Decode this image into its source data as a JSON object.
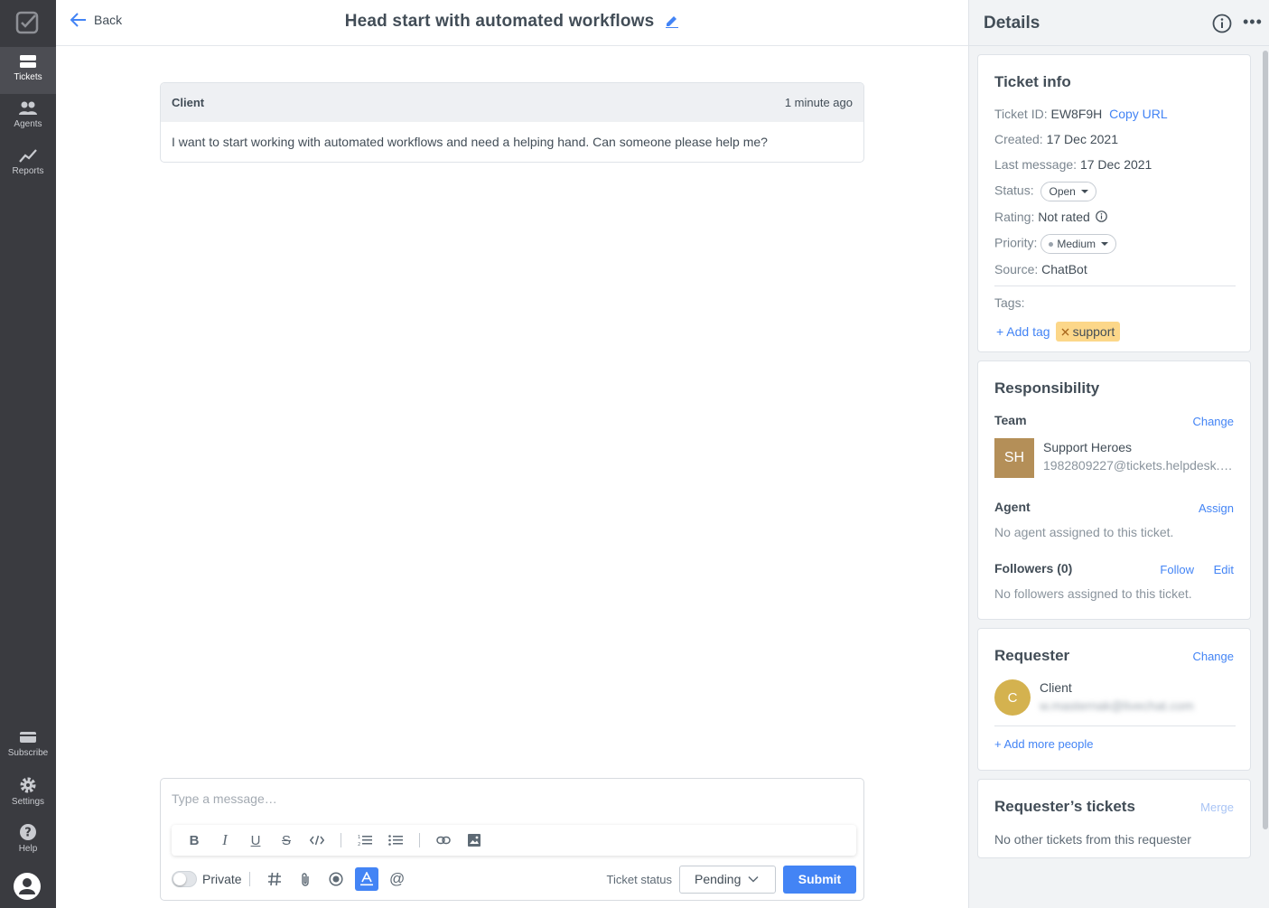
{
  "nav": {
    "items": [
      {
        "label": "Tickets",
        "icon": "ticket-icon"
      },
      {
        "label": "Agents",
        "icon": "agents-icon"
      },
      {
        "label": "Reports",
        "icon": "reports-icon"
      }
    ],
    "bottom_items": [
      {
        "label": "Subscribe",
        "icon": "subscribe-icon"
      },
      {
        "label": "Settings",
        "icon": "gear-icon"
      },
      {
        "label": "Help",
        "icon": "help-icon"
      }
    ]
  },
  "header": {
    "back_label": "Back",
    "title": "Head start with automated workflows"
  },
  "message": {
    "author": "Client",
    "time": "1 minute ago",
    "body": "I want to start working with automated workflows and need a helping hand. Can someone please help me?"
  },
  "composer": {
    "placeholder": "Type a message…",
    "private_label": "Private",
    "ticket_status_label": "Ticket status",
    "status_value": "Pending",
    "submit_label": "Submit"
  },
  "details": {
    "title": "Details",
    "ticket_info": {
      "title": "Ticket info",
      "ticket_id_label": "Ticket ID:",
      "ticket_id": "EW8F9H",
      "copy_url": "Copy URL",
      "created_label": "Created:",
      "created": "17 Dec 2021",
      "last_message_label": "Last message:",
      "last_message": "17 Dec 2021",
      "status_label": "Status:",
      "status": "Open",
      "rating_label": "Rating:",
      "rating": "Not rated",
      "priority_label": "Priority:",
      "priority": "Medium",
      "source_label": "Source:",
      "source": "ChatBot",
      "tags_label": "Tags:",
      "add_tag": "+ Add tag",
      "tag": "support"
    },
    "responsibility": {
      "title": "Responsibility",
      "team_label": "Team",
      "team_change": "Change",
      "team_initials": "SH",
      "team_name": "Support Heroes",
      "team_email": "1982809227@tickets.helpdesk.…",
      "agent_label": "Agent",
      "agent_assign": "Assign",
      "agent_empty": "No agent assigned to this ticket.",
      "followers_label": "Followers (0)",
      "follow": "Follow",
      "edit": "Edit",
      "followers_empty": "No followers assigned to this ticket."
    },
    "requester": {
      "title": "Requester",
      "change": "Change",
      "initial": "C",
      "name": "Client",
      "email": "w.masternak@livechat.com",
      "add_more": "+ Add more people"
    },
    "requester_tickets": {
      "title": "Requester’s tickets",
      "merge": "Merge",
      "empty": "No other tickets from this requester"
    }
  },
  "colors": {
    "accent": "#4384f5",
    "nav_bg": "#3a3b40",
    "tag_bg": "#fcd789",
    "team_avatar": "#b48f58",
    "requester_avatar": "#d4b24f"
  }
}
